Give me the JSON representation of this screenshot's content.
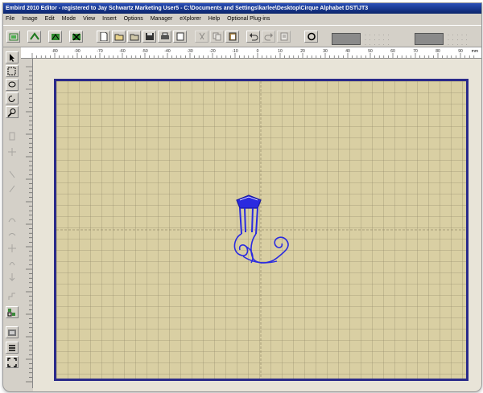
{
  "window": {
    "title": "Embird 2010 Editor - registered to Jay Schwartz Marketing User5 - C:\\Documents and Settings\\karlee\\Desktop\\Cirque Alphabet DST\\JT3"
  },
  "menu": [
    "File",
    "Image",
    "Edit",
    "Mode",
    "View",
    "Insert",
    "Options",
    "Manager",
    "eXplorer",
    "Help",
    "Optional Plug-ins"
  ],
  "ruler": {
    "top_ticks": [
      "-80",
      "-90",
      "-70",
      "-60",
      "-50",
      "-40",
      "-30",
      "-20",
      "-10",
      "0",
      "10",
      "20",
      "30",
      "40",
      "50",
      "60",
      "70",
      "80",
      "90"
    ],
    "unit": "mm"
  },
  "colors": {
    "hoop_border": "#2a2a8a",
    "canvas": "#d9cfa3",
    "design_stroke": "#2a2ae0"
  },
  "icons": {
    "toolbar": [
      "new-icon",
      "open-icon",
      "save-icon",
      "print-icon",
      "undo-icon",
      "redo-icon",
      "hoop-icon"
    ],
    "left": [
      "arrow-icon",
      "select-icon",
      "lasso-icon",
      "rotate-icon",
      "zoom-icon",
      "move-icon"
    ]
  }
}
